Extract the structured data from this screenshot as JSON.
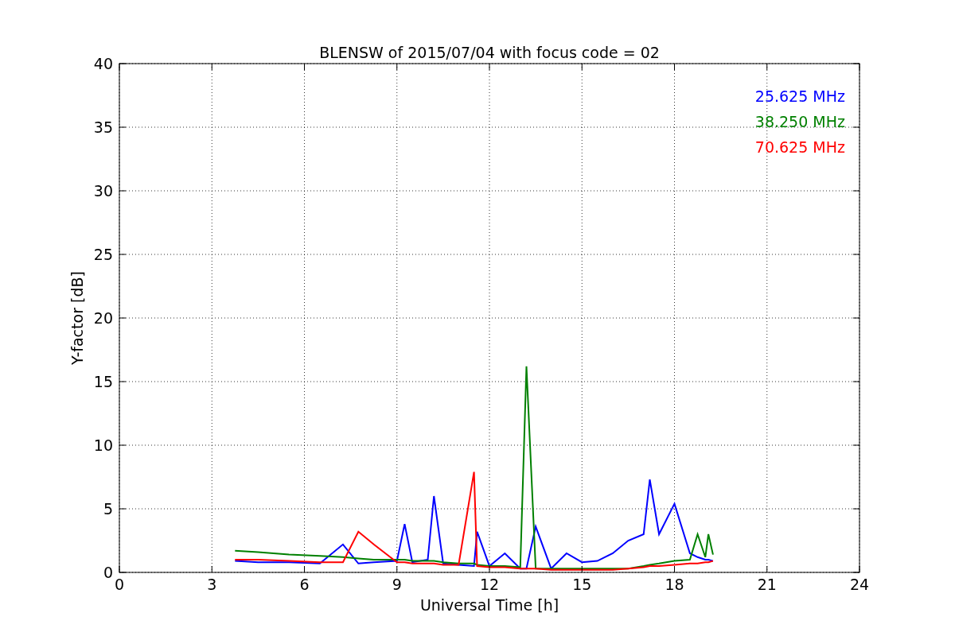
{
  "chart_data": {
    "type": "line",
    "title": "BLENSW of 2015/07/04 with focus code = 02",
    "xlabel": "Universal Time [h]",
    "ylabel": "Y-factor [dB]",
    "x": [
      3.75,
      4.5,
      5.5,
      6.5,
      7.25,
      7.75,
      8.25,
      9,
      9.25,
      9.5,
      10,
      10.2,
      10.5,
      11,
      11.5,
      11.6,
      12,
      12.5,
      13,
      13.2,
      13.5,
      14,
      14.5,
      15,
      15.5,
      16,
      16.5,
      17,
      17.2,
      17.5,
      18,
      18.5,
      18.75,
      19,
      19.1,
      19.25
    ],
    "series": [
      {
        "name": "25.625 MHz",
        "color": "#0000ff",
        "values": [
          0.9,
          0.8,
          0.8,
          0.7,
          2.2,
          0.7,
          0.8,
          0.9,
          3.8,
          0.8,
          1.0,
          6.0,
          0.7,
          0.6,
          0.5,
          3.2,
          0.5,
          1.5,
          0.3,
          0.3,
          3.6,
          0.3,
          1.5,
          0.8,
          0.9,
          1.5,
          2.5,
          3.0,
          7.3,
          3.0,
          5.4,
          1.5,
          1.2,
          1.0,
          1.0,
          0.9
        ]
      },
      {
        "name": "38.250 MHz",
        "color": "#008000",
        "values": [
          1.7,
          1.6,
          1.4,
          1.3,
          1.2,
          1.1,
          1.0,
          1.0,
          1.0,
          0.9,
          0.9,
          0.9,
          0.8,
          0.7,
          0.7,
          0.6,
          0.5,
          0.5,
          0.4,
          16.2,
          0.3,
          0.3,
          0.3,
          0.3,
          0.3,
          0.3,
          0.3,
          0.5,
          0.6,
          0.7,
          0.9,
          1.0,
          3.0,
          1.2,
          3.0,
          1.4
        ]
      },
      {
        "name": "70.625 MHz",
        "color": "#ff0000",
        "values": [
          1.0,
          1.0,
          0.9,
          0.8,
          0.8,
          3.2,
          2.2,
          0.8,
          0.8,
          0.7,
          0.7,
          0.7,
          0.6,
          0.6,
          7.9,
          0.5,
          0.4,
          0.4,
          0.3,
          0.3,
          0.3,
          0.2,
          0.2,
          0.2,
          0.2,
          0.2,
          0.3,
          0.4,
          0.5,
          0.5,
          0.6,
          0.7,
          0.7,
          0.8,
          0.8,
          0.9
        ]
      }
    ],
    "grid": true,
    "xlim": [
      0,
      24
    ],
    "ylim": [
      0,
      40
    ],
    "xticks": [
      0,
      3,
      6,
      9,
      12,
      15,
      18,
      21,
      24
    ],
    "yticks": [
      0,
      5,
      10,
      15,
      20,
      25,
      30,
      35,
      40
    ]
  }
}
